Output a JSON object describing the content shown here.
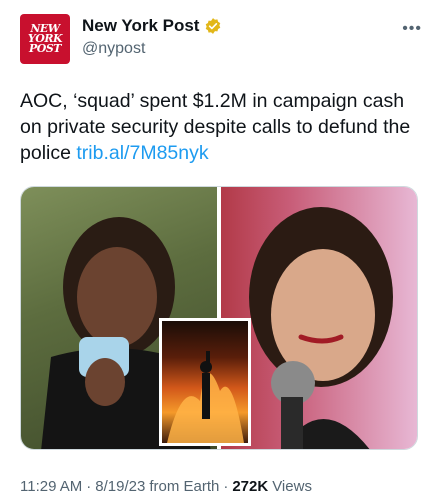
{
  "tweet": {
    "author": {
      "display_name": "New York Post",
      "handle": "@nypost",
      "avatar_text": [
        "NEW",
        "YORK",
        "POST"
      ],
      "verified": true
    },
    "text": "AOC, ‘squad’ spent $1.2M in campaign cash on private security despite calls to defund the police",
    "link": "trib.al/7M85nyk",
    "meta": {
      "time": "11:29 AM",
      "date": "8/19/23",
      "source": "from Earth",
      "views_count": "272K",
      "views_label": "Views"
    }
  },
  "icons": {
    "verified": "verified-badge-icon",
    "more": "more-options-icon"
  },
  "colors": {
    "link": "#1d9bf0",
    "brand_red": "#c8102e",
    "badge_gold": "#e2b719",
    "muted": "#536471"
  }
}
